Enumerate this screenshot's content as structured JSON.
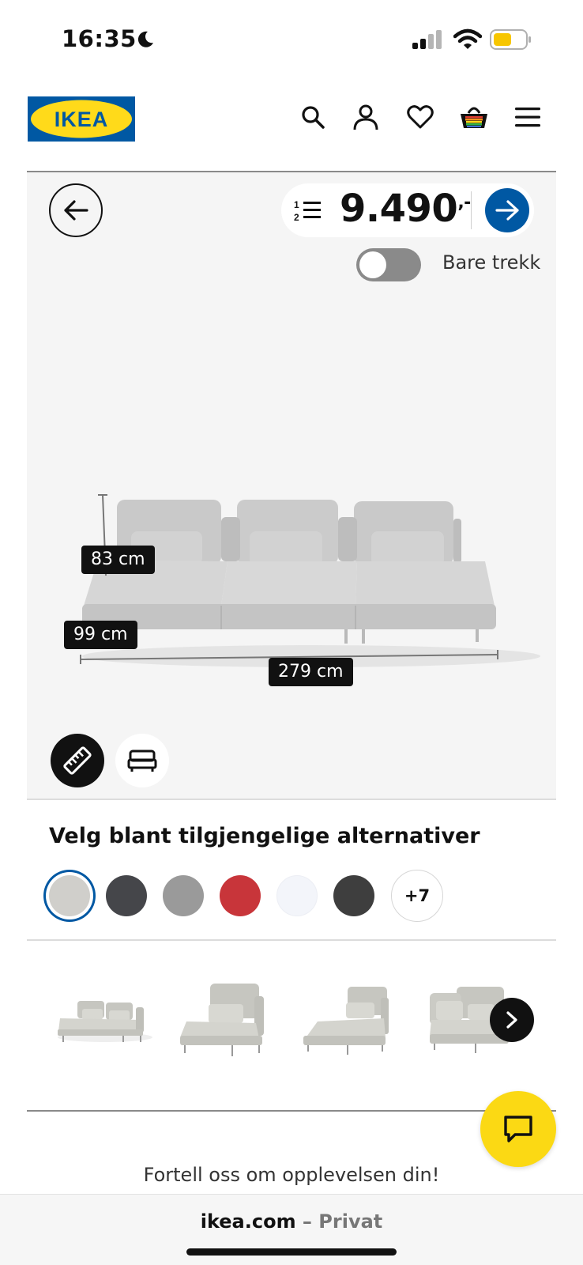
{
  "status_bar": {
    "time": "16:35",
    "moon_icon": "moon-icon",
    "signal_icon": "cellular-signal-icon",
    "wifi_icon": "wifi-icon",
    "battery_icon": "battery-icon",
    "battery_color": "#f7c600"
  },
  "header": {
    "logo_text": "IKEA",
    "logo_colors": {
      "blue": "#0058a3",
      "yellow": "#ffda1a"
    },
    "icons": [
      "search-icon",
      "account-icon",
      "heart-icon",
      "basket-icon",
      "menu-icon"
    ]
  },
  "configurator": {
    "price": "9.490",
    "price_suffix": ",-",
    "toggle_label": "Bare trekk",
    "toggle_on": false,
    "dimensions": {
      "height": "83 cm",
      "depth": "99 cm",
      "width": "279 cm"
    },
    "view_buttons": [
      "ruler-icon",
      "bed-icon"
    ]
  },
  "options": {
    "heading": "Velg blant tilgjengelige alternativer",
    "swatches": [
      {
        "color": "#d0cfcb",
        "selected": true
      },
      {
        "color": "#45464a",
        "selected": false
      },
      {
        "color": "#9a9a9a",
        "selected": false
      },
      {
        "color": "#c8353a",
        "selected": false
      },
      {
        "color": "#f3f5fa",
        "selected": false
      },
      {
        "color": "#3e3e3e",
        "selected": false
      }
    ],
    "more_label": "+7"
  },
  "feedback_text": "Fortell oss om opplevelsen din!",
  "browser": {
    "domain": "ikea.com",
    "separator": " – ",
    "mode": "Privat"
  }
}
